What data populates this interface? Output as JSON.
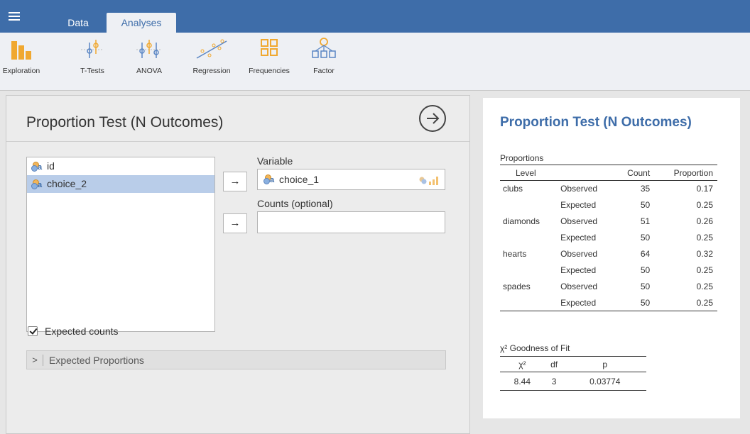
{
  "tabs": {
    "data": "Data",
    "analyses": "Analyses"
  },
  "ribbon": [
    {
      "label": "Exploration",
      "icon": "exploration-icon"
    },
    {
      "label": "T-Tests",
      "icon": "t-tests-icon"
    },
    {
      "label": "ANOVA",
      "icon": "anova-icon"
    },
    {
      "label": "Regression",
      "icon": "regression-icon"
    },
    {
      "label": "Frequencies",
      "icon": "frequencies-icon"
    },
    {
      "label": "Factor",
      "icon": "factor-icon"
    }
  ],
  "analysis": {
    "title": "Proportion Test (N Outcomes)",
    "variables": [
      "id",
      "choice_2"
    ],
    "selected_variable": "choice_2",
    "variable_label": "Variable",
    "variable_value": "choice_1",
    "counts_label": "Counts (optional)",
    "counts_value": "",
    "expected_counts_label": "Expected counts",
    "expected_counts_checked": true,
    "expected_props_label": "Expected Proportions"
  },
  "results": {
    "title": "Proportion Test (N Outcomes)",
    "table_caption": "Proportions",
    "headers": {
      "level": "Level",
      "count": "Count",
      "proportion": "Proportion"
    },
    "rows": [
      {
        "level": "clubs",
        "obs_label": "Observed",
        "obs_count": "35",
        "obs_prop": "0.17",
        "exp_label": "Expected",
        "exp_count": "50",
        "exp_prop": "0.25"
      },
      {
        "level": "diamonds",
        "obs_label": "Observed",
        "obs_count": "51",
        "obs_prop": "0.26",
        "exp_label": "Expected",
        "exp_count": "50",
        "exp_prop": "0.25"
      },
      {
        "level": "hearts",
        "obs_label": "Observed",
        "obs_count": "64",
        "obs_prop": "0.32",
        "exp_label": "Expected",
        "exp_count": "50",
        "exp_prop": "0.25"
      },
      {
        "level": "spades",
        "obs_label": "Observed",
        "obs_count": "50",
        "obs_prop": "0.25",
        "exp_label": "Expected",
        "exp_count": "50",
        "exp_prop": "0.25"
      }
    ],
    "gof_caption": "χ² Goodness of Fit",
    "gof_headers": {
      "chi": "χ²",
      "df": "df",
      "p": "p"
    },
    "gof_values": {
      "chi": "8.44",
      "df": "3",
      "p": "0.03774"
    }
  },
  "colors": {
    "brand": "#3e6da9",
    "ribbon_icon": "#f0a830",
    "selected_row": "#b9cde9"
  }
}
